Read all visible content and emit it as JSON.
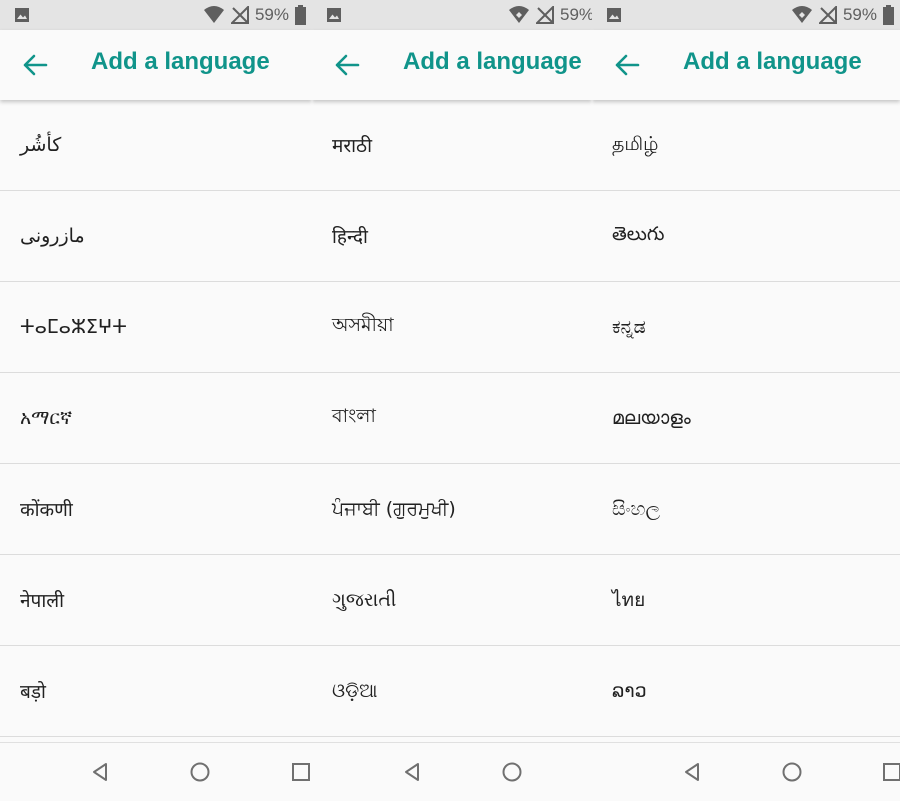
{
  "title": "Add a language",
  "colors": {
    "accent": "#10948a",
    "statusbar": "#e4e4e4"
  },
  "panels": [
    {
      "battery": "59%",
      "items": [
        "كأشُر",
        "مازرونی",
        "ⵜⴰⵎⴰⵣⵉⵖⵜ",
        "አማርኛ",
        "कोंकणी",
        "नेपाली",
        "बड़ो"
      ]
    },
    {
      "battery": "59%",
      "items": [
        "मराठी",
        "हिन्दी",
        "অসমীয়া",
        "বাংলা",
        "ਪੰਜਾਬੀ (ਗੁਰਮੁਖੀ)",
        "ગુજરાતી",
        "ଓଡ଼ିଆ"
      ]
    },
    {
      "battery": "59%",
      "items": [
        "தமிழ்",
        "తెలుగు",
        "ಕನ್ನಡ",
        "മലയാളം",
        "සිංහල",
        "ไทย",
        "ລາວ"
      ]
    }
  ],
  "icons": {
    "status_left": "image-notification-icon",
    "wifi": "wifi-icon",
    "signal": "no-signal-icon",
    "battery": "battery-icon",
    "back": "back-arrow-icon",
    "nav": [
      "nav-back-icon",
      "nav-home-icon",
      "nav-recents-icon"
    ]
  }
}
